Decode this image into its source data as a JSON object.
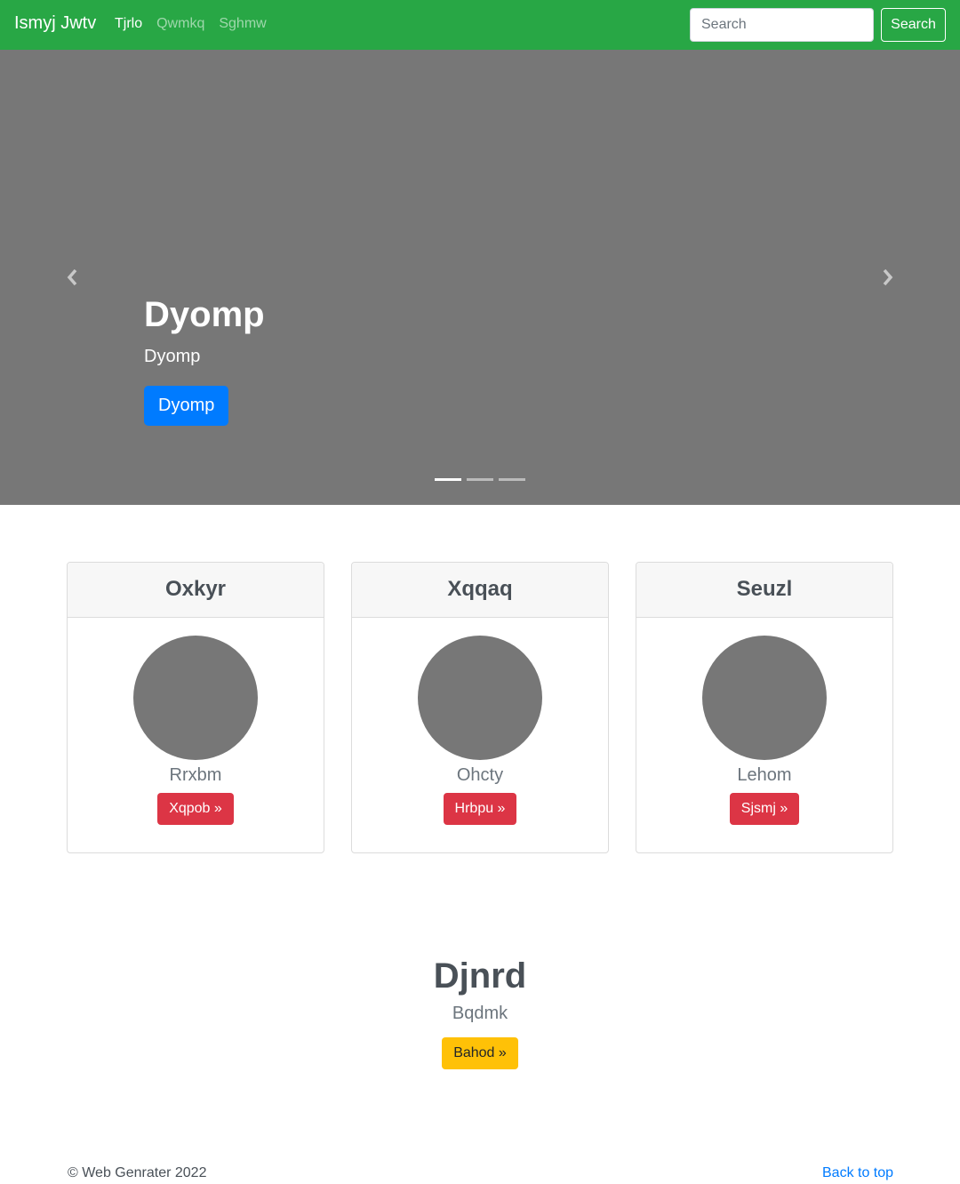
{
  "navbar": {
    "brand": "Ismyj Jwtv",
    "links": [
      {
        "label": "Tjrlo",
        "active": true
      },
      {
        "label": "Qwmkq",
        "active": false
      },
      {
        "label": "Sghmw",
        "active": false
      }
    ],
    "search_placeholder": "Search",
    "search_button": "Search",
    "colors": {
      "background": "#28a745"
    }
  },
  "carousel": {
    "title": "Dyomp",
    "text": "Dyomp",
    "button": "Dyomp",
    "prev_icon": "chevron-left-icon",
    "next_icon": "chevron-right-icon",
    "slide_count": 3,
    "active_slide": 1,
    "colors": {
      "background": "#777777",
      "button": "#007bff"
    }
  },
  "cards": [
    {
      "header": "Oxkyr",
      "text": "Rrxbm",
      "button": "Xqpob »"
    },
    {
      "header": "Xqqaq",
      "text": "Ohcty",
      "button": "Hrbpu »"
    },
    {
      "header": "Seuzl",
      "text": "Lehom",
      "button": "Sjsmj »"
    }
  ],
  "feature": {
    "title": "Djnrd",
    "text": "Bqdmk",
    "button": "Bahod »"
  },
  "footer": {
    "copyright": "© Web Genrater 2022",
    "back_to_top": "Back to top"
  }
}
